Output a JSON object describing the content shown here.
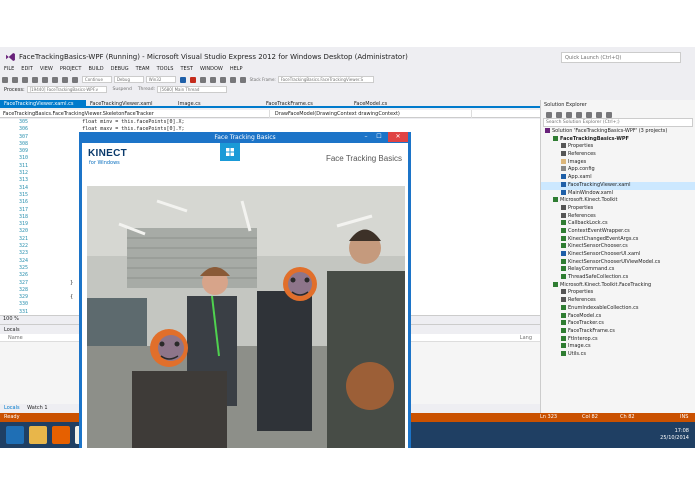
{
  "window": {
    "title": "FaceTrackingBasics-WPF (Running) - Microsoft Visual Studio Express 2012 for Windows Desktop (Administrator)",
    "quick_launch_placeholder": "Quick Launch (Ctrl+Q)"
  },
  "menu": [
    "FILE",
    "EDIT",
    "VIEW",
    "PROJECT",
    "BUILD",
    "DEBUG",
    "TEAM",
    "TOOLS",
    "TEST",
    "WINDOW",
    "HELP"
  ],
  "toolbar": {
    "continue_label": "Continue",
    "config_value": "Debug",
    "platform_value": "Win32",
    "stack_frame_label": "Stack Frame:",
    "stack_frame_value": "FaceTrackingBasics.FaceTrackingViewer.S"
  },
  "process_bar": {
    "process_label": "Process:",
    "process_value": "[19440] FaceTrackingBasics-WPF.v",
    "suspend_label": "Suspend",
    "thread_label": "Thread:",
    "thread_value": "[5680] Main Thread"
  },
  "editor_tabs": [
    {
      "label": "FaceTrackingViewer.xaml.cs",
      "active": true
    },
    {
      "label": "FaceTrackingViewer.xaml",
      "active": false
    },
    {
      "label": "Image.cs",
      "active": false
    },
    {
      "label": "FaceTrackFrame.cs",
      "active": false
    },
    {
      "label": "FaceModel.cs",
      "active": false
    }
  ],
  "navbar": {
    "class_value": "FaceTrackingBasics.FaceTrackingViewer.SkeletonFaceTracker",
    "method_value": "DrawFaceModel(DrawingContext drawingContext)"
  },
  "line_numbers": [
    "305",
    "306",
    "307",
    "308",
    "309",
    "310",
    "311",
    "312",
    "313",
    "314",
    "315",
    "316",
    "317",
    "318",
    "319",
    "320",
    "321",
    "322",
    "323",
    "324",
    "325",
    "326",
    "327",
    "328",
    "329",
    "330",
    "331",
    "332"
  ],
  "code_lines": [
    "                float minv = this.facePoints[0].X;",
    "                float maxv = this.facePoints[0].Y;",
    "",
    "",
    "",
    "",
    "",
    "",
    "",
    "",
    "",
    "",
    "",
    "",
    "",
    "",
    "",
    "",
    "",
    "",
    "",
    "",
    "            }",
    "",
    "            {",
    "",
    "",
    ""
  ],
  "zoom": "100 %",
  "locals": {
    "title": "Locals",
    "col_name": "Name",
    "col_lang": "Lang",
    "tabs": [
      {
        "label": "Locals",
        "active": true
      },
      {
        "label": "Watch 1",
        "active": false
      }
    ]
  },
  "solution_explorer": {
    "title": "Solution Explorer",
    "search_placeholder": "Search Solution Explorer (Ctrl+;)",
    "items": [
      {
        "label": "Solution 'FaceTrackingBasics-WPF' (3 projects)",
        "indent": 0,
        "icon": "solution-icon",
        "selected": false,
        "bold": false
      },
      {
        "label": "FaceTrackingBasics-WPF",
        "indent": 1,
        "icon": "csproj-icon",
        "selected": false,
        "bold": true
      },
      {
        "label": "Properties",
        "indent": 2,
        "icon": "wrench-icon",
        "selected": false,
        "bold": false
      },
      {
        "label": "References",
        "indent": 2,
        "icon": "references-icon",
        "selected": false,
        "bold": false
      },
      {
        "label": "Images",
        "indent": 2,
        "icon": "folder-icon",
        "selected": false,
        "bold": false
      },
      {
        "label": "App.config",
        "indent": 2,
        "icon": "config-icon",
        "selected": false,
        "bold": false
      },
      {
        "label": "App.xaml",
        "indent": 2,
        "icon": "xaml-icon",
        "selected": false,
        "bold": false
      },
      {
        "label": "FaceTrackingViewer.xaml",
        "indent": 2,
        "icon": "xaml-icon",
        "selected": true,
        "bold": false
      },
      {
        "label": "MainWindow.xaml",
        "indent": 2,
        "icon": "xaml-icon",
        "selected": false,
        "bold": false
      },
      {
        "label": "Microsoft.Kinect.Toolkit",
        "indent": 1,
        "icon": "csproj-icon",
        "selected": false,
        "bold": false
      },
      {
        "label": "Properties",
        "indent": 2,
        "icon": "wrench-icon",
        "selected": false,
        "bold": false
      },
      {
        "label": "References",
        "indent": 2,
        "icon": "references-icon",
        "selected": false,
        "bold": false
      },
      {
        "label": "CallbackLock.cs",
        "indent": 2,
        "icon": "cs-file-icon",
        "selected": false,
        "bold": false
      },
      {
        "label": "ContextEventWrapper.cs",
        "indent": 2,
        "icon": "cs-file-icon",
        "selected": false,
        "bold": false
      },
      {
        "label": "KinectChangedEventArgs.cs",
        "indent": 2,
        "icon": "cs-file-icon",
        "selected": false,
        "bold": false
      },
      {
        "label": "KinectSensorChooser.cs",
        "indent": 2,
        "icon": "cs-file-icon",
        "selected": false,
        "bold": false
      },
      {
        "label": "KinectSensorChooserUI.xaml",
        "indent": 2,
        "icon": "xaml-icon",
        "selected": false,
        "bold": false
      },
      {
        "label": "KinectSensorChooserUIViewModel.cs",
        "indent": 2,
        "icon": "cs-file-icon",
        "selected": false,
        "bold": false
      },
      {
        "label": "RelayCommand.cs",
        "indent": 2,
        "icon": "cs-file-icon",
        "selected": false,
        "bold": false
      },
      {
        "label": "ThreadSafeCollection.cs",
        "indent": 2,
        "icon": "cs-file-icon",
        "selected": false,
        "bold": false
      },
      {
        "label": "Microsoft.Kinect.Toolkit.FaceTracking",
        "indent": 1,
        "icon": "csproj-icon",
        "selected": false,
        "bold": false
      },
      {
        "label": "Properties",
        "indent": 2,
        "icon": "wrench-icon",
        "selected": false,
        "bold": false
      },
      {
        "label": "References",
        "indent": 2,
        "icon": "references-icon",
        "selected": false,
        "bold": false
      },
      {
        "label": "EnumIndexableCollection.cs",
        "indent": 2,
        "icon": "cs-file-icon",
        "selected": false,
        "bold": false
      },
      {
        "label": "FaceModel.cs",
        "indent": 2,
        "icon": "cs-file-icon",
        "selected": false,
        "bold": false
      },
      {
        "label": "FaceTracker.cs",
        "indent": 2,
        "icon": "cs-file-icon",
        "selected": false,
        "bold": false
      },
      {
        "label": "FaceTrackFrame.cs",
        "indent": 2,
        "icon": "cs-file-icon",
        "selected": false,
        "bold": false
      },
      {
        "label": "FtInterop.cs",
        "indent": 2,
        "icon": "cs-file-icon",
        "selected": false,
        "bold": false
      },
      {
        "label": "Image.cs",
        "indent": 2,
        "icon": "cs-file-icon",
        "selected": false,
        "bold": false
      },
      {
        "label": "Utils.cs",
        "indent": 2,
        "icon": "cs-file-icon",
        "selected": false,
        "bold": false
      }
    ]
  },
  "status": {
    "text": "Ready",
    "ln": "Ln 323",
    "col": "Col 82",
    "ch": "Ch 82",
    "mode": "INS"
  },
  "clock": {
    "time": "17:08",
    "date": "25/10/2014"
  },
  "taskbar_icons": [
    "start-icon",
    "explorer-icon",
    "firefox-icon",
    "notepad-icon",
    "network-icon",
    "cmd-icon",
    "terminal-icon",
    "app-icon",
    "eclipse-icon",
    "skype-icon",
    "visual-studio-icon",
    "app2-icon",
    "media-icon",
    "photoshop-icon",
    "window-icon"
  ],
  "app_window": {
    "title": "Face Tracking Basics",
    "brand": "KINECT",
    "brand_sub": "for Windows",
    "header_title": "Face Tracking Basics"
  },
  "colors": {
    "accent": "#007acc",
    "status_bar": "#ca5100",
    "app_title_bar": "#1c74c8",
    "taskbar": "#1f3f63",
    "close_button": "#e04343"
  }
}
